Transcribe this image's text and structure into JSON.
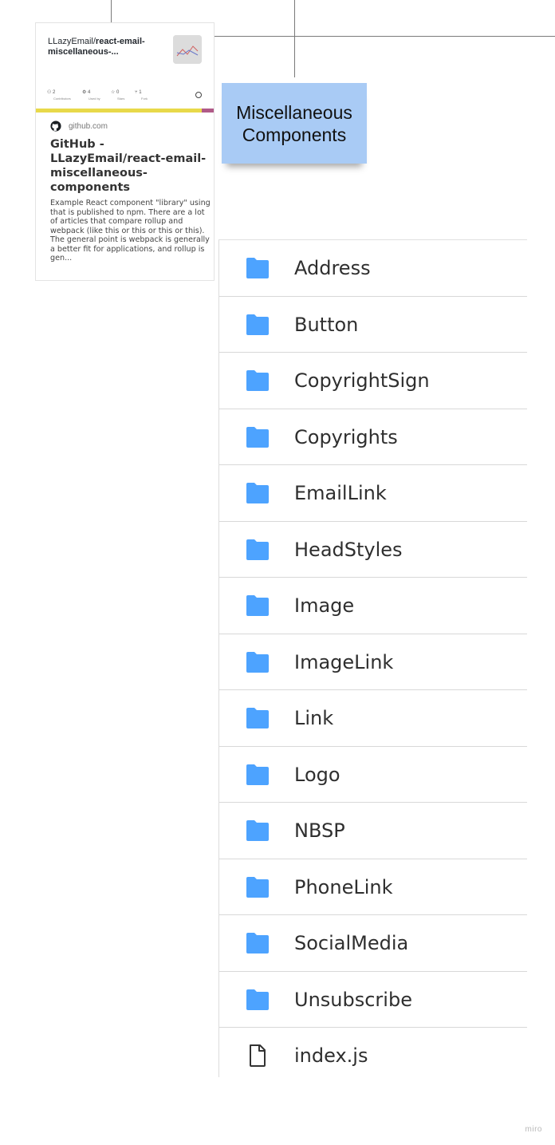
{
  "preview_card": {
    "og_owner": "LLazyEmail/",
    "og_repo": "react-email-miscellaneous-...",
    "stats": [
      {
        "value": "2",
        "label": "Contributors"
      },
      {
        "value": "4",
        "label": "Used by"
      },
      {
        "value": "0",
        "label": "Stars"
      },
      {
        "value": "1",
        "label": "Fork"
      }
    ],
    "site": "github.com",
    "title": "GitHub - LLazyEmail/react-email-miscellaneous-components",
    "description": "Example React component \"library\" using that is published to npm. There are a lot of articles that compare rollup and webpack (like this or this or this or this). The general point is webpack is generally a better fit for applications, and rollup is gen..."
  },
  "sticky_note": {
    "text": "Miscellaneous Components",
    "color": "#a9cbf5"
  },
  "file_list": {
    "folder_icon_color": "#4da3ff",
    "items": [
      {
        "name": "Address",
        "type": "folder"
      },
      {
        "name": "Button",
        "type": "folder"
      },
      {
        "name": "CopyrightSign",
        "type": "folder"
      },
      {
        "name": "Copyrights",
        "type": "folder"
      },
      {
        "name": "EmailLink",
        "type": "folder"
      },
      {
        "name": "HeadStyles",
        "type": "folder"
      },
      {
        "name": "Image",
        "type": "folder"
      },
      {
        "name": "ImageLink",
        "type": "folder"
      },
      {
        "name": "Link",
        "type": "folder"
      },
      {
        "name": "Logo",
        "type": "folder"
      },
      {
        "name": "NBSP",
        "type": "folder"
      },
      {
        "name": "PhoneLink",
        "type": "folder"
      },
      {
        "name": "SocialMedia",
        "type": "folder"
      },
      {
        "name": "Unsubscribe",
        "type": "folder"
      },
      {
        "name": "index.js",
        "type": "file"
      }
    ]
  },
  "watermark": "miro"
}
